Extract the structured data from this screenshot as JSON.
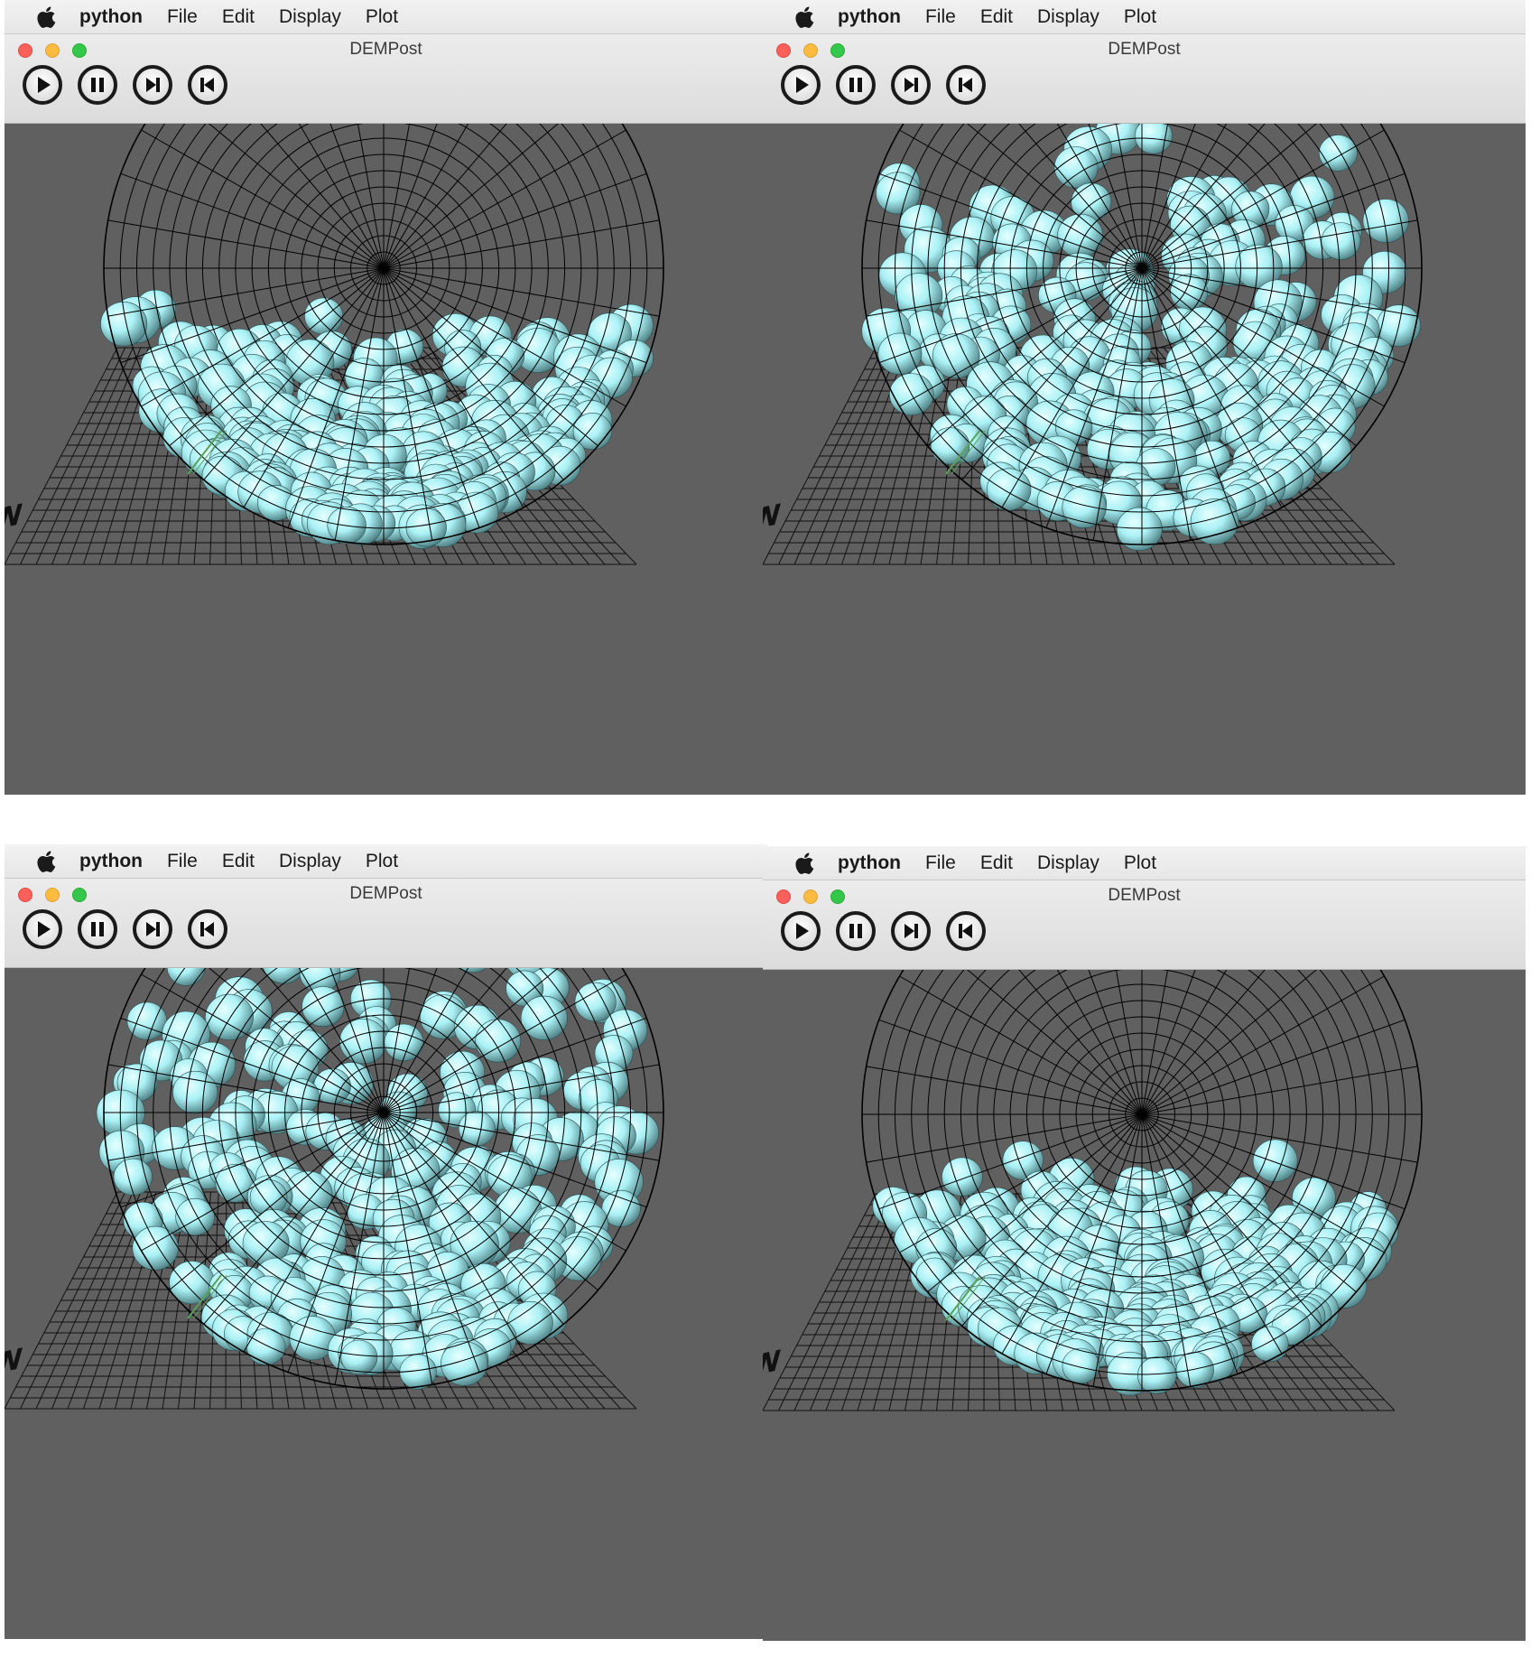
{
  "menubar": {
    "apple_icon": "apple-logo-icon",
    "app_name": "python",
    "items": [
      "File",
      "Edit",
      "Display",
      "Plot"
    ]
  },
  "window": {
    "title": "DEMPost",
    "traffic_lights": {
      "close": "#fc605b",
      "minimize": "#fdbc40",
      "zoom": "#34c84a"
    }
  },
  "toolbar": {
    "buttons": [
      {
        "name": "play-button",
        "icon": "play-icon"
      },
      {
        "name": "pause-button",
        "icon": "pause-icon"
      },
      {
        "name": "step-forward-button",
        "icon": "step-forward-icon"
      },
      {
        "name": "step-backward-button",
        "icon": "step-backward-icon"
      }
    ]
  },
  "scene": {
    "background": "#606060",
    "particle_color": "#aaf1f5",
    "wireframe_color": "#000000",
    "axis_label": "N"
  },
  "panels": [
    {
      "id": "top-left"
    },
    {
      "id": "top-right"
    },
    {
      "id": "bottom-left"
    },
    {
      "id": "bottom-right"
    }
  ]
}
